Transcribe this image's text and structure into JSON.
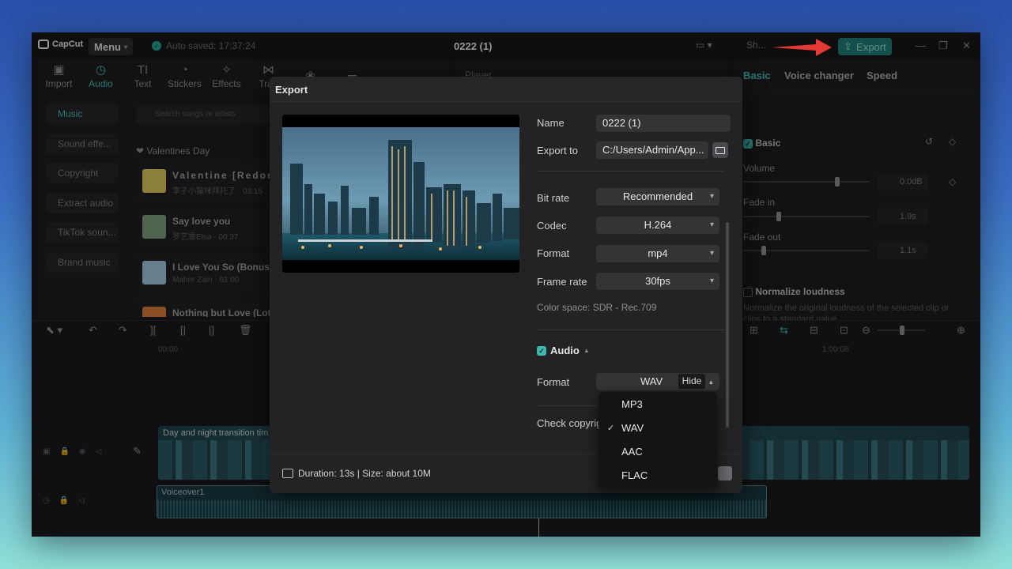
{
  "app": {
    "logo": "CapCut",
    "menu_label": "Menu",
    "autosave": "Auto saved: 17:37:24",
    "doc_title": "0222 (1)",
    "shortcut_label": "Sh...",
    "export_label": "Export"
  },
  "toolbar": {
    "items": [
      {
        "label": "Import",
        "icon": "import-icon"
      },
      {
        "label": "Audio",
        "icon": "audio-icon"
      },
      {
        "label": "Text",
        "icon": "text-icon"
      },
      {
        "label": "Stickers",
        "icon": "stickers-icon"
      },
      {
        "label": "Effects",
        "icon": "effects-icon"
      },
      {
        "label": "Tran",
        "icon": "transitions-icon"
      }
    ]
  },
  "sidebar": {
    "items": [
      "Music",
      "Sound effe...",
      "Copyright",
      "Extract audio",
      "TikTok soun...",
      "Brand music"
    ]
  },
  "library": {
    "search_placeholder": "Search songs or artists",
    "category": "❤ Valentines Day",
    "songs": [
      {
        "title": "Valentine [Redor",
        "sub": "李子小猫咪拜托了 · 03:15"
      },
      {
        "title": "Say love you",
        "sub": "罗艺霏Elsa · 00:37"
      },
      {
        "title": "I Love You So (Bonus T",
        "sub": "Maher Zain · 01:00"
      },
      {
        "title": "Nothing but Love (Lot",
        "sub": ""
      }
    ]
  },
  "player": {
    "label": "Player"
  },
  "right_panel": {
    "tabs": [
      "Basic",
      "Voice changer",
      "Speed"
    ],
    "section": "Basic",
    "volume_label": "Volume",
    "volume_value": "0.0dB",
    "fade_in_label": "Fade in",
    "fade_in_value": "1.9s",
    "fade_out_label": "Fade out",
    "fade_out_value": "1.1s",
    "normalize_label": "Normalize loudness",
    "normalize_desc": "Normalize the original loudness of the selected clip or clips to a standard value"
  },
  "timeline": {
    "ruler_start": "00:00",
    "ruler_end": "1:00:08",
    "video_clip": "Day and night transition tim",
    "voice_clip": "Voiceover1"
  },
  "export_dialog": {
    "title": "Export",
    "name_label": "Name",
    "name_value": "0222 (1)",
    "export_to_label": "Export to",
    "export_to_value": "C:/Users/Admin/App...",
    "bitrate_label": "Bit rate",
    "bitrate_value": "Recommended",
    "codec_label": "Codec",
    "codec_value": "H.264",
    "format_label": "Format",
    "format_value": "mp4",
    "framerate_label": "Frame rate",
    "framerate_value": "30fps",
    "color_space": "Color space: SDR - Rec.709",
    "audio_label": "Audio",
    "audio_format_label": "Format",
    "audio_format_value": "WAV",
    "hide_label": "Hide",
    "check_copyright": "Check copyrig",
    "footer": "Duration: 13s | Size: about 10M",
    "format_options": [
      "MP3",
      "WAV",
      "AAC",
      "FLAC"
    ],
    "selected_option": "WAV"
  },
  "colors": {
    "accent": "#3fb8ae",
    "export_button": "#1f7c74",
    "arrow": "#e53935"
  }
}
